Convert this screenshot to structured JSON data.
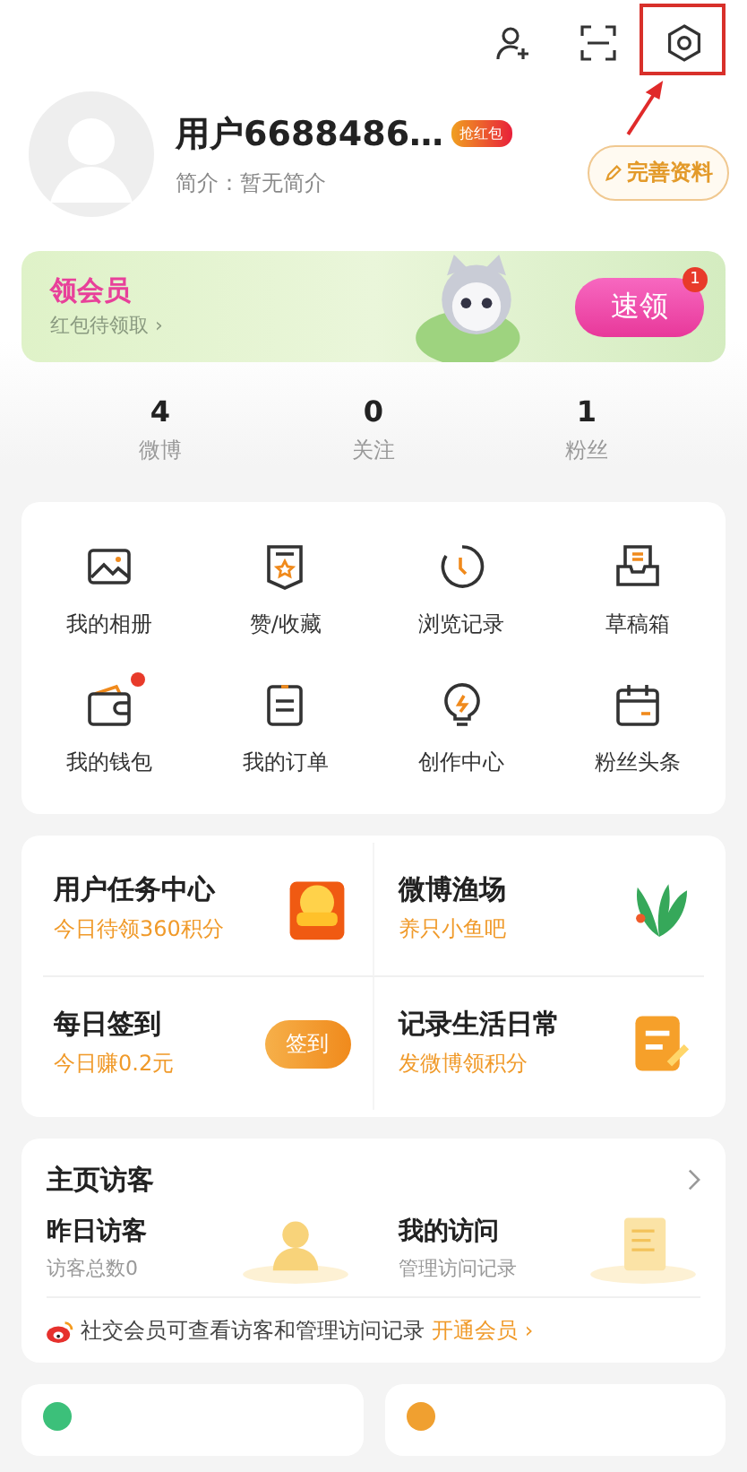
{
  "profile": {
    "name": "用户6688486…",
    "tag": "抢红包",
    "bio": "简介：暂无简介",
    "edit_button": "完善资料"
  },
  "banner": {
    "title": "领会员",
    "subtitle": "红包待领取 ›",
    "button": "速领",
    "badge": "1"
  },
  "stats": [
    {
      "value": "4",
      "label": "微博"
    },
    {
      "value": "0",
      "label": "关注"
    },
    {
      "value": "1",
      "label": "粉丝"
    }
  ],
  "shortcuts": [
    {
      "label": "我的相册",
      "dot": false
    },
    {
      "label": "赞/收藏",
      "dot": false
    },
    {
      "label": "浏览记录",
      "dot": false
    },
    {
      "label": "草稿箱",
      "dot": false
    },
    {
      "label": "我的钱包",
      "dot": true
    },
    {
      "label": "我的订单",
      "dot": false
    },
    {
      "label": "创作中心",
      "dot": false
    },
    {
      "label": "粉丝头条",
      "dot": false
    }
  ],
  "tasks": [
    {
      "title": "用户任务中心",
      "subtitle": "今日待领360积分",
      "kind": "image"
    },
    {
      "title": "微博渔场",
      "subtitle": "养只小鱼吧",
      "kind": "image"
    },
    {
      "title": "每日签到",
      "subtitle": "今日赚0.2元",
      "kind": "button",
      "button": "签到"
    },
    {
      "title": "记录生活日常",
      "subtitle": "发微博领积分",
      "kind": "image"
    }
  ],
  "visitors": {
    "title": "主页访客",
    "items": [
      {
        "title": "昨日访客",
        "subtitle": "访客总数0"
      },
      {
        "title": "我的访问",
        "subtitle": "管理访问记录"
      }
    ],
    "notice": "社交会员可查看访客和管理访问记录",
    "notice_link": "开通会员 ›"
  }
}
